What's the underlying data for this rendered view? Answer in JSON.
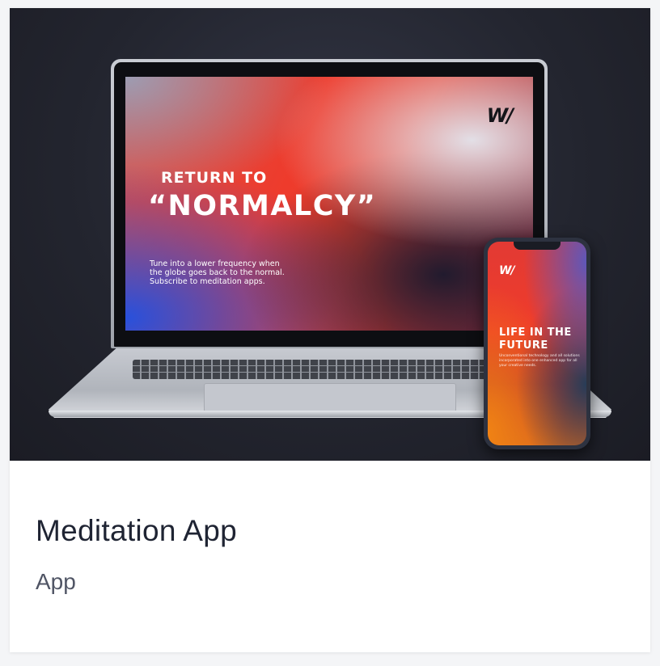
{
  "card": {
    "title": "Meditation App",
    "category": "App"
  },
  "laptop_screen": {
    "logo": "W/",
    "kicker": "RETURN TO",
    "headline": "“NORMALCY”",
    "body": "Tune into a lower frequency when the globe goes back to the normal. Subscribe to meditation apps."
  },
  "phone_screen": {
    "logo": "W/",
    "headline": "LIFE IN THE FUTURE",
    "body": "Unconventional technology and all solutions incorporated into one enhanced app for all your creative needs."
  },
  "colors": {
    "card_background": "#ffffff",
    "page_background": "#f4f5f7",
    "hero_background": "#23252f",
    "title_text": "#1f2433",
    "subtitle_text": "#505565",
    "accent_red": "#ee3b2c",
    "accent_blue": "#2850dc"
  },
  "icons": {
    "brand_logo": "brand-logo-icon"
  }
}
